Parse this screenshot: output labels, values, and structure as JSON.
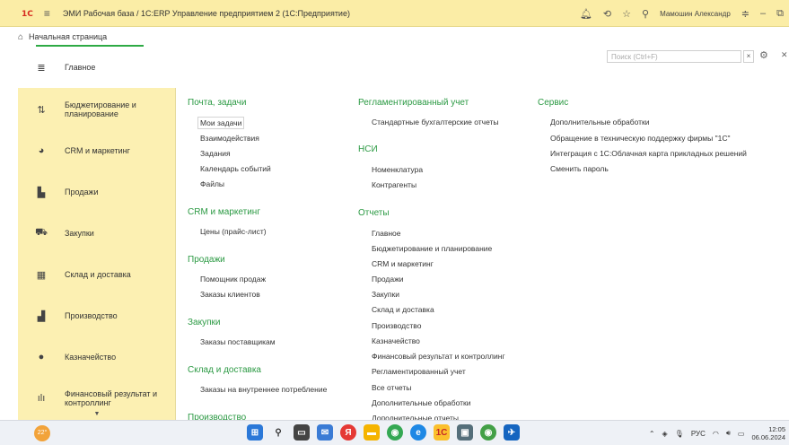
{
  "titlebar": {
    "logo": "1C",
    "app_title": "ЭМИ Рабочая база / 1С:ERP Управление предприятием 2  (1С:Предприятие)",
    "user": "Мамошин Александр"
  },
  "home_tab": {
    "label": "Начальная страница"
  },
  "sidebar": {
    "items": [
      {
        "label": "Главное",
        "icon": "menu-lines-icon"
      },
      {
        "label": "Бюджетирование и планирование",
        "icon": "budget-icon"
      },
      {
        "label": "CRM и маркетинг",
        "icon": "pie-chart-icon"
      },
      {
        "label": "Продажи",
        "icon": "bag-icon"
      },
      {
        "label": "Закупки",
        "icon": "cart-icon"
      },
      {
        "label": "Склад и доставка",
        "icon": "warehouse-icon"
      },
      {
        "label": "Производство",
        "icon": "factory-icon"
      },
      {
        "label": "Казначейство",
        "icon": "coin-icon"
      },
      {
        "label": "Финансовый результат и контроллинг",
        "icon": "bar-chart-icon"
      }
    ]
  },
  "search": {
    "placeholder": "Поиск (Ctrl+F)",
    "clear_label": "×"
  },
  "col1": {
    "sections": [
      {
        "title": "Почта, задачи",
        "links": [
          "Мои задачи",
          "Взаимодействия",
          "Задания",
          "Календарь событий",
          "Файлы"
        ]
      },
      {
        "title": "CRM и маркетинг",
        "links": [
          "Цены (прайс-лист)"
        ]
      },
      {
        "title": "Продажи",
        "links": [
          "Помощник продаж",
          "Заказы клиентов"
        ]
      },
      {
        "title": "Закупки",
        "links": [
          "Заказы поставщикам"
        ]
      },
      {
        "title": "Склад и доставка",
        "links": [
          "Заказы на внутреннее потребление"
        ]
      },
      {
        "title": "Производство",
        "links": []
      }
    ]
  },
  "col2": {
    "sections": [
      {
        "title": "Регламентированный учет",
        "links": [
          "Стандартные бухгалтерские отчеты"
        ]
      },
      {
        "title": "НСИ",
        "links": [
          "Номенклатура",
          "Контрагенты"
        ]
      },
      {
        "title": "Отчеты",
        "links": [
          "Главное",
          "Бюджетирование и планирование",
          "CRM и маркетинг",
          "Продажи",
          "Закупки",
          "Склад и доставка",
          "Производство",
          "Казначейство",
          "Финансовый результат и контроллинг",
          "Регламентированный учет",
          "Все отчеты",
          "Дополнительные обработки",
          "Дополнительные отчеты"
        ]
      }
    ]
  },
  "col3": {
    "sections": [
      {
        "title": "Сервис",
        "links": [
          "Дополнительные обработки",
          "Обращение в техническую поддержку фирмы \"1С\"",
          "Интеграция с 1С:Облачная карта прикладных решений",
          "Сменить пароль"
        ]
      }
    ]
  },
  "taskbar": {
    "weather": "22°",
    "lang": "РУС",
    "time": "12:05",
    "date": "06.06.2024"
  }
}
